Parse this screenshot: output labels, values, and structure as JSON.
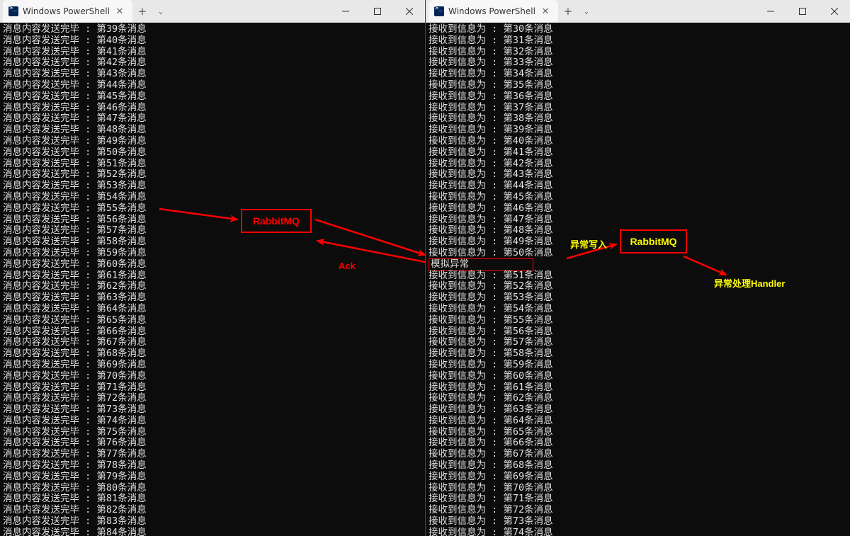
{
  "left_window": {
    "tab_title": "Windows PowerShell",
    "line_prefix": "消息内容发送完毕 : 第",
    "line_suffix": "条消息",
    "start_num": 39,
    "end_num": 84
  },
  "right_window": {
    "tab_title": "Windows PowerShell",
    "line_prefix": "接收到信息为 : 第",
    "line_suffix": "条消息",
    "start_num": 30,
    "break_num": 50,
    "end_num": 74,
    "exception_text": "模拟异常"
  },
  "annotations": {
    "rabbitmq_left": "RabbitMQ",
    "rabbitmq_right": "RabbitMQ",
    "ack_label": "Ack",
    "abnormal_write_label": "异常写入",
    "handler_label": "异常处理Handler"
  },
  "icons": {
    "tab_close": "✕",
    "new_tab": "+",
    "dropdown": "⌄",
    "minimize": "—",
    "maximize": "▢",
    "close": "✕"
  }
}
